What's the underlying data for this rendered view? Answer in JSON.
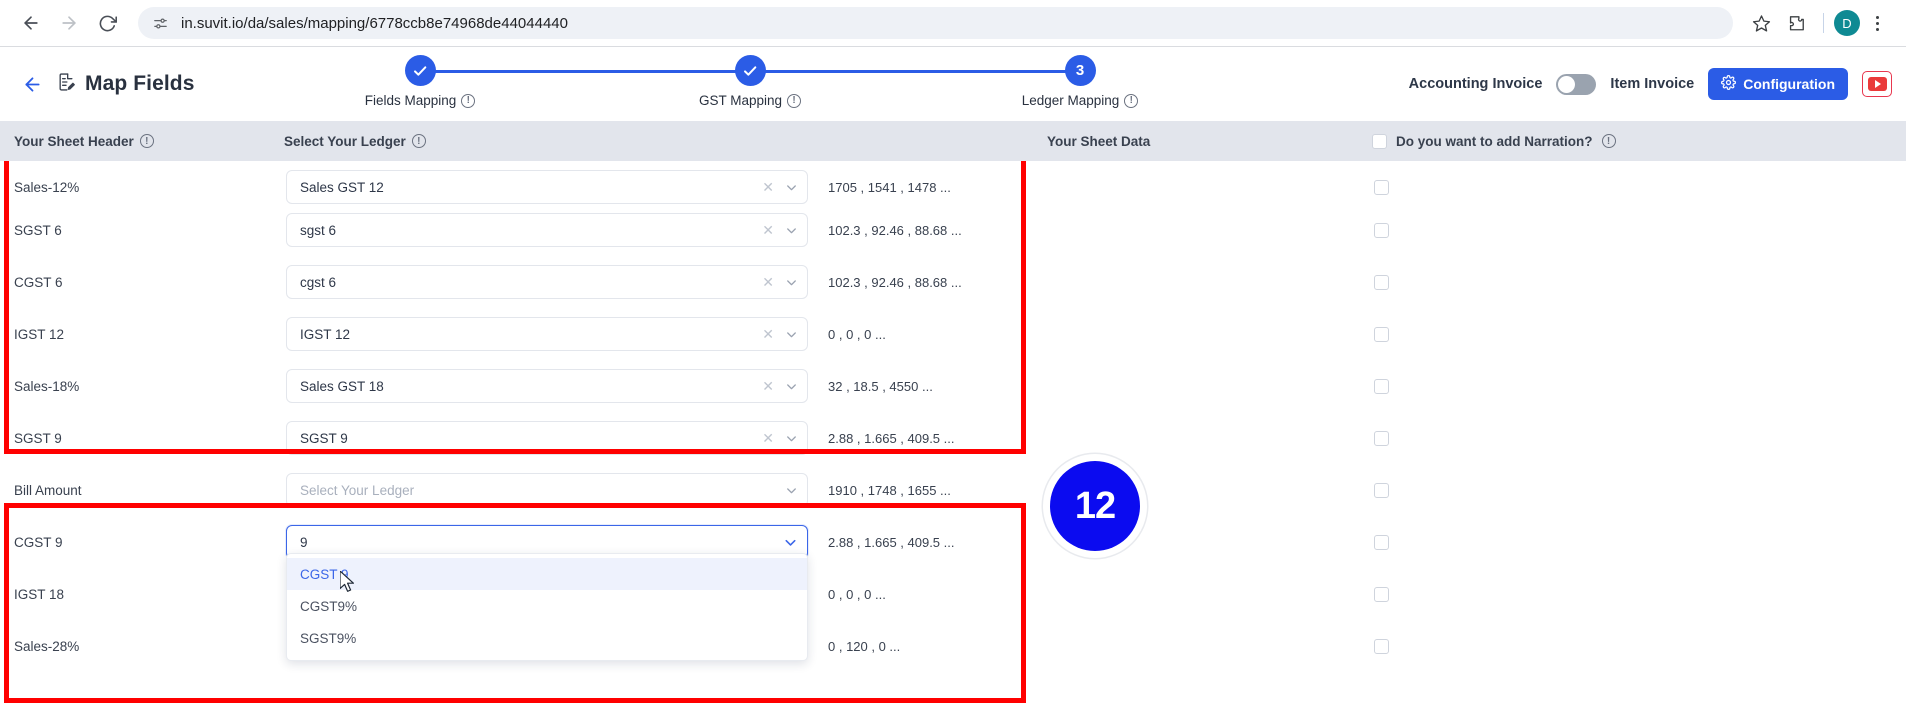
{
  "browser": {
    "url": "in.suvit.io/da/sales/mapping/6778ccb8e74968de44044440",
    "back_icon": "arrow-left-icon",
    "forward_icon": "arrow-right-icon",
    "reload_icon": "reload-icon",
    "site_info_icon": "site-settings-icon",
    "bookmark_icon": "star-icon",
    "extensions_icon": "puzzle-icon",
    "profile_initial": "D",
    "menu_icon": "kebab-menu-icon"
  },
  "app": {
    "back_label": "back",
    "title": "Map Fields",
    "title_icon": "document-edit-icon",
    "stepper": [
      {
        "label": "Fields Mapping",
        "node": "✓",
        "state": "complete",
        "pos": 0
      },
      {
        "label": "GST Mapping",
        "node": "✓",
        "state": "complete",
        "pos": 50
      },
      {
        "label": "Ledger Mapping",
        "node": "3",
        "state": "current",
        "pos": 100
      }
    ],
    "invoice_toggle": {
      "left_label": "Accounting Invoice",
      "right_label": "Item Invoice",
      "state": "off"
    },
    "configuration_label": "Configuration",
    "configuration_icon": "gear-icon",
    "youtube_label": "youtube-help"
  },
  "table": {
    "columns": [
      {
        "label": "Your Sheet Header",
        "info": true
      },
      {
        "label": "Select Your Ledger",
        "info": true
      },
      {
        "label": "Your Sheet Data",
        "info": false
      },
      {
        "label": "Do you want to add Narration?",
        "info": true,
        "checkbox": true
      }
    ],
    "select_placeholder": "Select Your Ledger",
    "rows": [
      {
        "header": "Sales-12%",
        "ledger": "Sales GST 12",
        "data": "1705 , 1541 , 1478 ...",
        "narration": false,
        "clearable": true
      },
      {
        "header": "SGST 6",
        "ledger": "sgst 6",
        "data": "102.3 , 92.46 , 88.68 ...",
        "narration": false,
        "clearable": true
      },
      {
        "header": "CGST 6",
        "ledger": "cgst 6",
        "data": "102.3 , 92.46 , 88.68 ...",
        "narration": false,
        "clearable": true
      },
      {
        "header": "IGST 12",
        "ledger": "IGST 12",
        "data": "0 , 0 , 0 ...",
        "narration": false,
        "clearable": true
      },
      {
        "header": "Sales-18%",
        "ledger": "Sales GST 18",
        "data": "32 , 18.5 , 4550 ...",
        "narration": false,
        "clearable": true
      },
      {
        "header": "SGST 9",
        "ledger": "SGST 9",
        "data": "2.88 , 1.665 , 409.5 ...",
        "narration": false,
        "clearable": true
      },
      {
        "header": "Bill Amount",
        "ledger": "",
        "data": "1910 , 1748 , 1655 ...",
        "narration": false,
        "clearable": false
      },
      {
        "header": "CGST 9",
        "ledger": "9",
        "data": "2.88 , 1.665 , 409.5 ...",
        "narration": false,
        "clearable": false,
        "focused": true
      },
      {
        "header": "IGST 18",
        "ledger": "",
        "data": "0 , 0 , 0 ...",
        "narration": false,
        "clearable": false
      },
      {
        "header": "Sales-28%",
        "ledger": "",
        "data": "0 , 120 , 0 ...",
        "narration": false,
        "clearable": false
      }
    ]
  },
  "dropdown": {
    "open_for_row": "CGST 9",
    "query": "9",
    "options": [
      {
        "label": "CGST 9",
        "highlighted": true
      },
      {
        "label": "CGST9%",
        "highlighted": false
      },
      {
        "label": "SGST9%",
        "highlighted": false
      }
    ]
  },
  "overlay": {
    "badge_value": "12",
    "badge_color": "#0b0bf0",
    "annotation_color": "#ff0000",
    "annotations": 2
  }
}
